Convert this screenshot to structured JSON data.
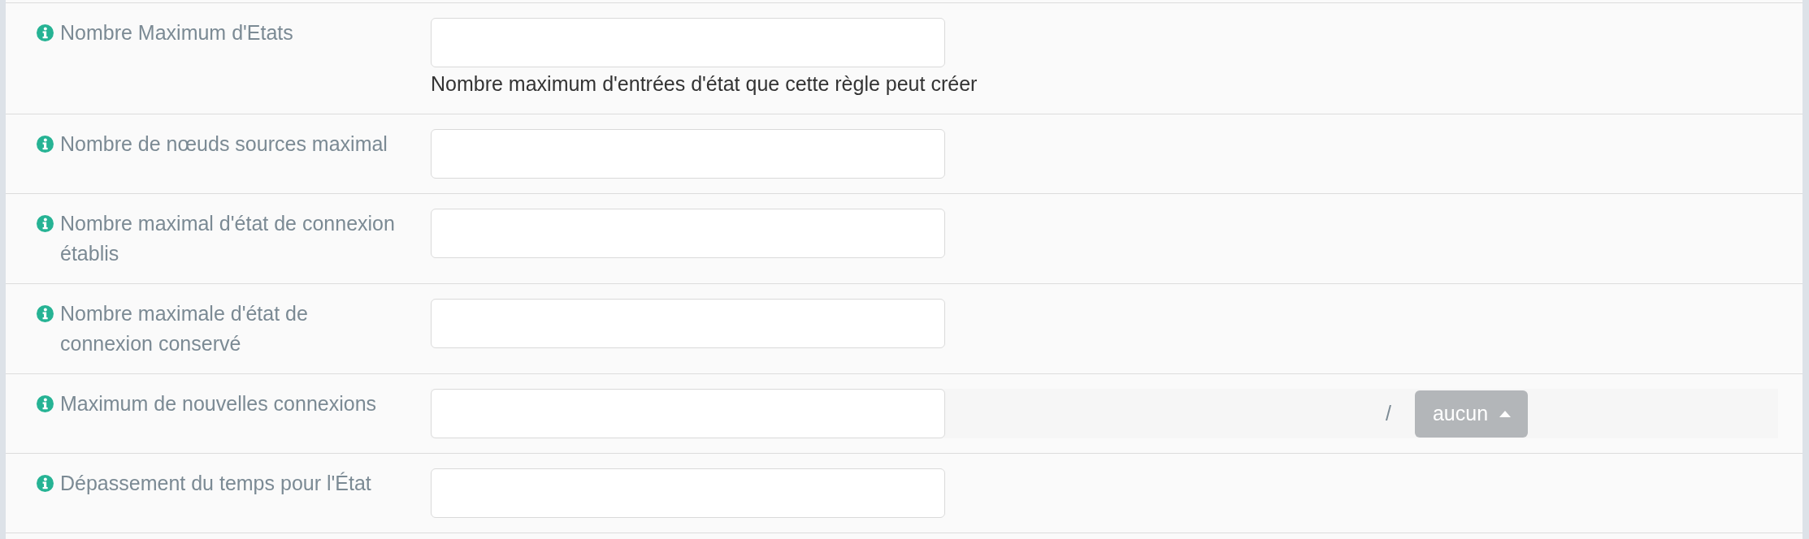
{
  "fields": [
    {
      "kind": "text",
      "label": "Nombre Maximum d'Etats",
      "help": "Nombre maximum d'entrées d'état que cette règle peut créer"
    },
    {
      "kind": "text",
      "label": "Nombre de nœuds sources maximal"
    },
    {
      "kind": "text",
      "label": "Nombre maximal d'état de connexion établis"
    },
    {
      "kind": "text",
      "label": "Nombre maximale d'état de connexion conservé"
    },
    {
      "kind": "rate",
      "label": "Maximum de nouvelles connexions",
      "separator": "/",
      "unit_button": {
        "label": "aucun"
      }
    },
    {
      "kind": "text",
      "label": "Dépassement du temps pour l'État"
    }
  ]
}
